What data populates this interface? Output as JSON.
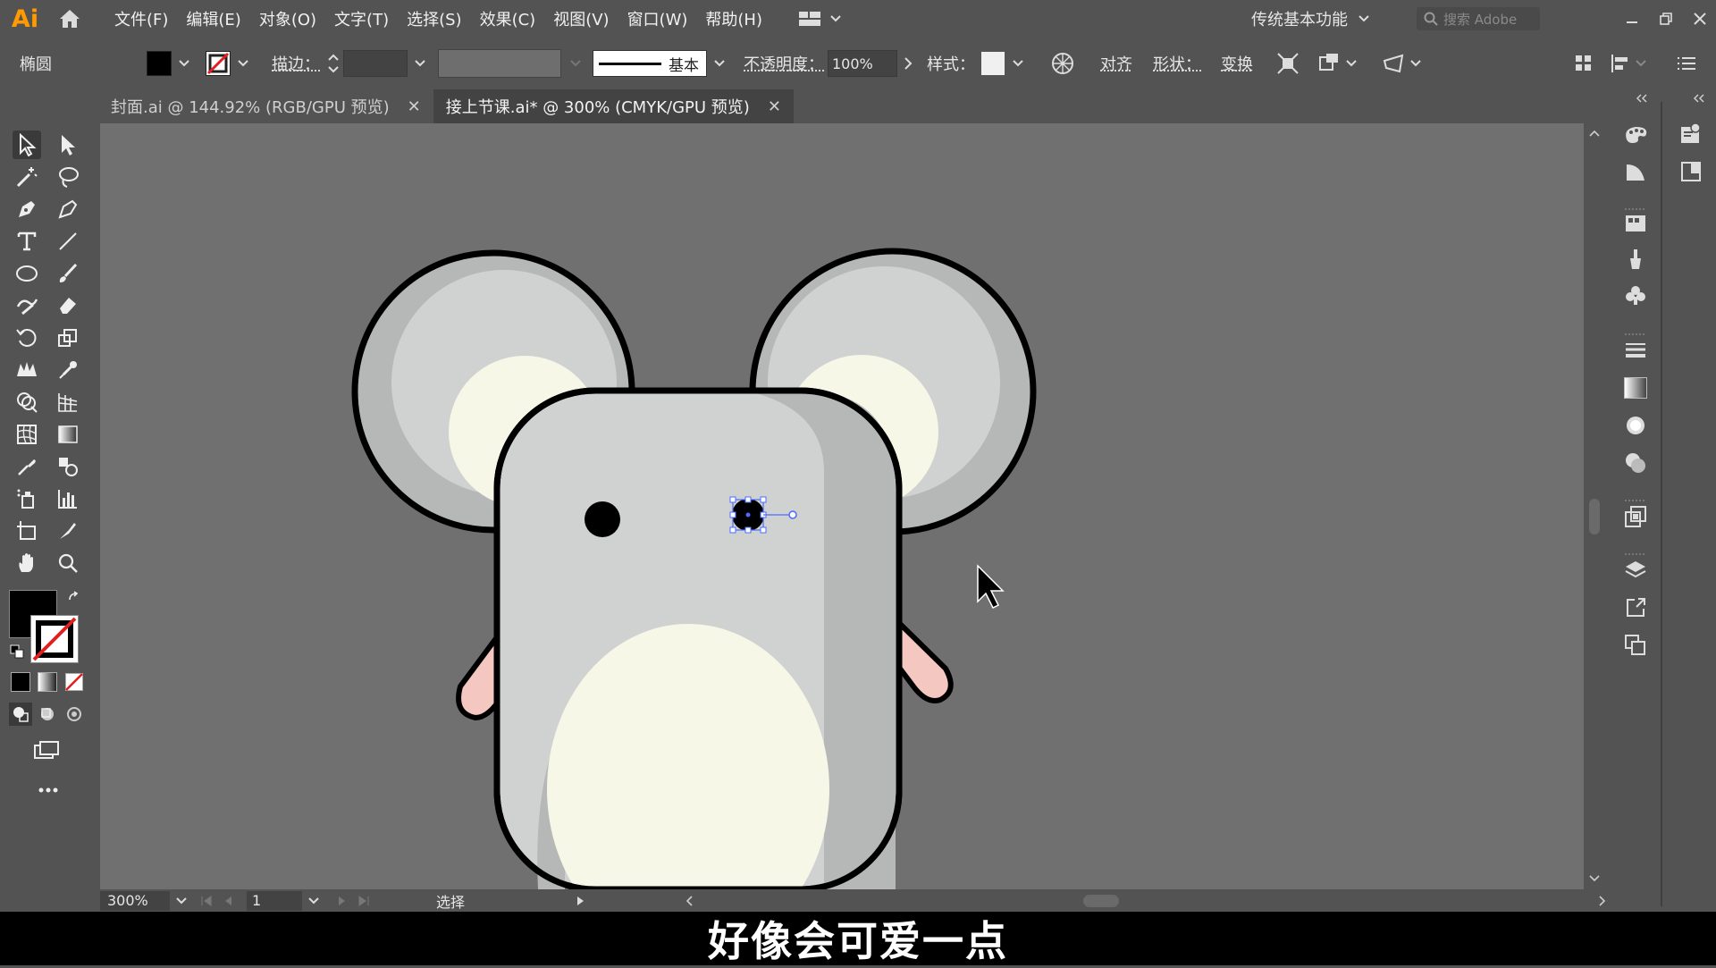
{
  "app": {
    "logo": "Ai",
    "menu": [
      "文件(F)",
      "编辑(E)",
      "对象(O)",
      "文字(T)",
      "选择(S)",
      "效果(C)",
      "视图(V)",
      "窗口(W)",
      "帮助(H)"
    ],
    "workspace": "传统基本功能",
    "search_placeholder": "搜索 Adobe"
  },
  "controlbar": {
    "object_type": "椭圆",
    "stroke_label": "描边：",
    "brush_label": "基本",
    "opacity_label": "不透明度：",
    "opacity_value": "100%",
    "style_label": "样式：",
    "align_label": "对齐",
    "shape_label": "形状：",
    "transform_label": "变换"
  },
  "tabs": [
    {
      "label": "封面.ai @ 144.92% (RGB/GPU 预览)",
      "active": false
    },
    {
      "label": "接上节课.ai* @ 300% (CMYK/GPU 预览)",
      "active": true
    }
  ],
  "statusbar": {
    "zoom": "300%",
    "artboard": "1",
    "tool_status": "选择"
  },
  "subtitle": "好像会可爱一点",
  "colors": {
    "canvas": "#707070",
    "ui_bg": "#535353",
    "mouse_body": "#d0d2d2",
    "mouse_shadow": "#b6b8b8",
    "ear_inner": "#f6f7e6",
    "arm": "#f4c7c0",
    "selection": "#4a6cff"
  }
}
